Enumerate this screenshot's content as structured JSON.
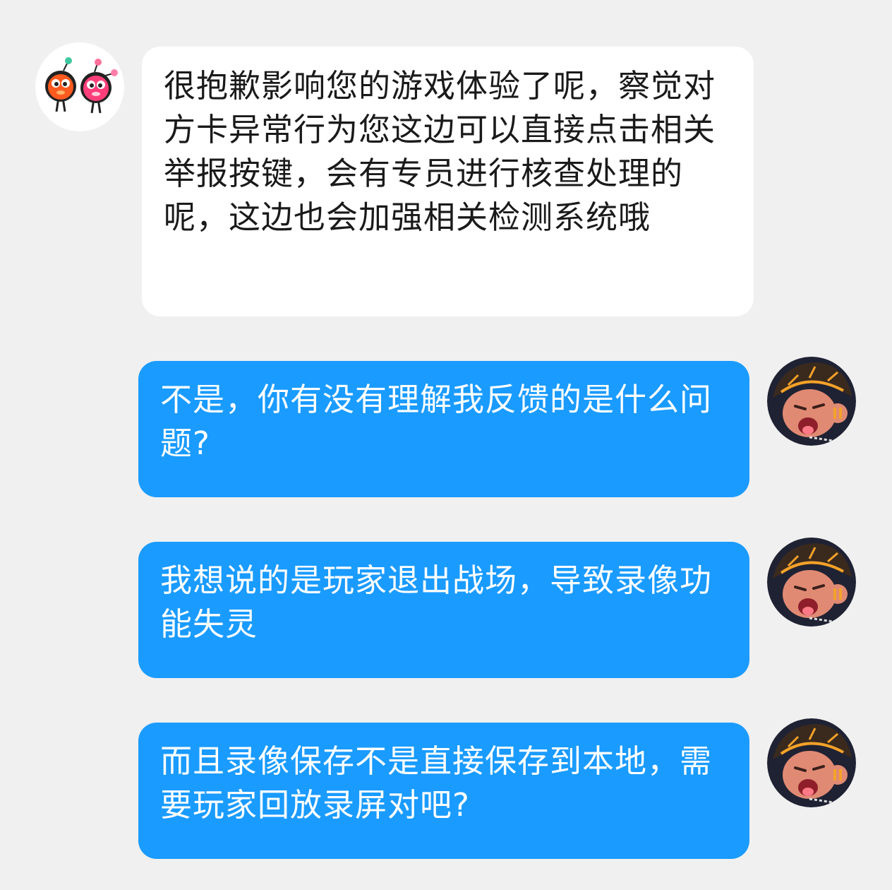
{
  "messages": [
    {
      "side": "incoming",
      "avatar": "cartoon-mascots-avatar",
      "text": "很抱歉影响您的游戏体验了呢，察觉对方卡异常行为您这边可以直接点击相关举报按键，会有专员进行核查处理的呢，这边也会加强相关检测系统哦"
    },
    {
      "side": "outgoing",
      "avatar": "player-avatar",
      "text": "不是，你有没有理解我反馈的是什么问题?"
    },
    {
      "side": "outgoing",
      "avatar": "player-avatar",
      "text": "我想说的是玩家退出战场，导致录像功能失灵"
    },
    {
      "side": "outgoing",
      "avatar": "player-avatar",
      "text": "而且录像保存不是直接保存到本地，需要玩家回放录屏对吧?"
    }
  ],
  "colors": {
    "background": "#f0f0f0",
    "incoming_bubble": "#ffffff",
    "outgoing_bubble": "#1a9bff",
    "incoming_text": "#1a1a1a",
    "outgoing_text": "#ffffff"
  }
}
